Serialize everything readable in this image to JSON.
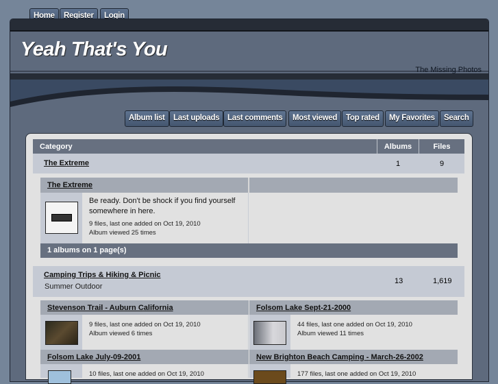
{
  "top_nav": [
    "Home",
    "Register",
    "Login"
  ],
  "site_title": "Yeah That's You",
  "tagline": "The Missing Photos",
  "main_nav": [
    "Album list",
    "Last uploads",
    "Last comments",
    "Most viewed",
    "Top rated",
    "My Favorites",
    "Search"
  ],
  "table": {
    "headers": {
      "category": "Category",
      "albums": "Albums",
      "files": "Files"
    }
  },
  "categories": [
    {
      "name": "The Extreme",
      "description": "",
      "albums": "1",
      "files": "9",
      "album_list": [
        {
          "title": "The Extreme",
          "description": "Be ready. Don't be shock if you find yourself somewhere in here.",
          "files_info": "9 files, last one added on Oct 19, 2010",
          "views": "Album viewed 25 times"
        }
      ],
      "footer": "1 albums on 1 page(s)"
    },
    {
      "name": "Camping Trips & Hiking & Picnic",
      "description": "Summer Outdoor",
      "albums": "13",
      "files": "1,619",
      "album_list": [
        {
          "title": "Stevenson Trail - Auburn California",
          "files_info": "9 files, last one added on Oct 19, 2010",
          "views": "Album viewed 6 times"
        },
        {
          "title": "Folsom Lake Sept-21-2000",
          "files_info": "44 files, last one added on Oct 19, 2010",
          "views": "Album viewed 11 times"
        },
        {
          "title": "Folsom Lake July-09-2001",
          "files_info": "10 files, last one added on Oct 19, 2010"
        },
        {
          "title": "New Brighton Beach Camping - March-26-2002",
          "files_info": "177 files, last one added on Oct 19, 2010"
        }
      ]
    }
  ]
}
